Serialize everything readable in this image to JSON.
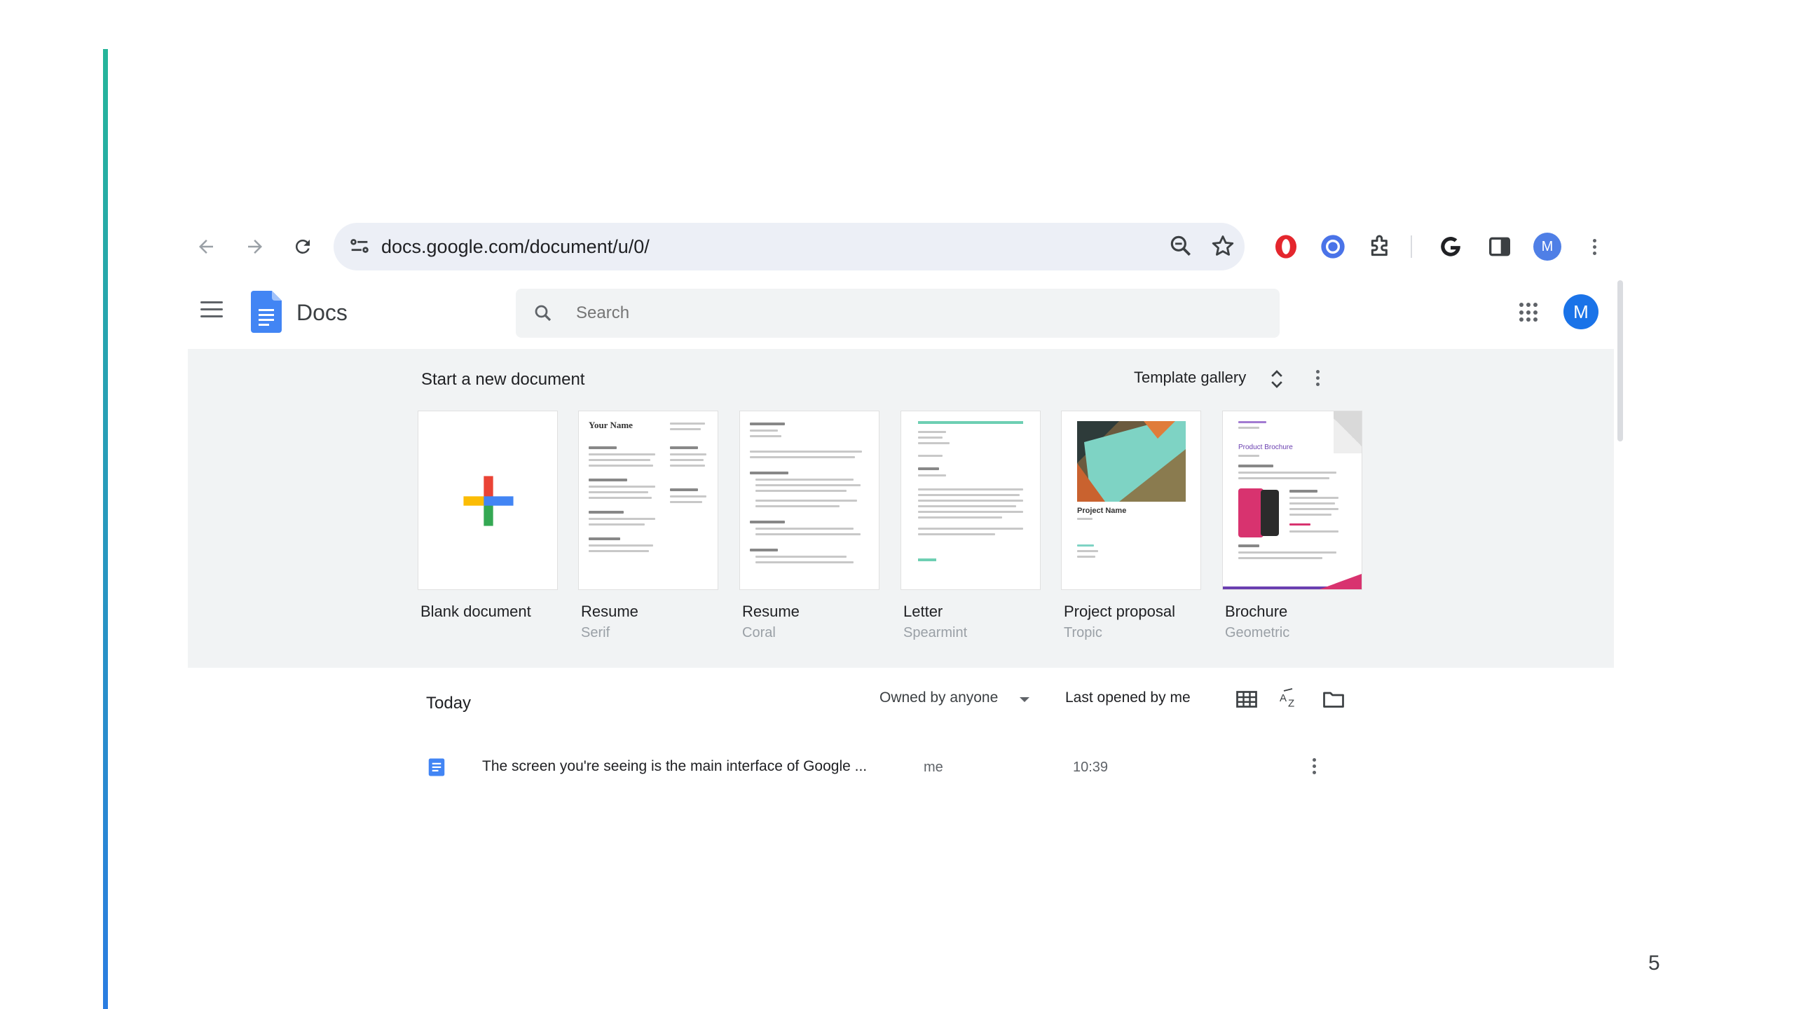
{
  "browser": {
    "url": "docs.google.com/document/u/0/",
    "profile_initial": "M",
    "colors": {
      "opera_red": "#e4262d",
      "ext_blue": "#4a73e8",
      "avatar_blue": "#4f7fe6"
    }
  },
  "app": {
    "name": "Docs",
    "search_placeholder": "Search",
    "account_initial": "M",
    "colors": {
      "accent": "#1a73e8",
      "docs_blue": "#4285f4"
    }
  },
  "templates": {
    "title": "Start a new document",
    "gallery_label": "Template gallery",
    "items": [
      {
        "name": "Blank document",
        "sub": ""
      },
      {
        "name": "Resume",
        "sub": "Serif",
        "thumb_heading": "Your Name"
      },
      {
        "name": "Resume",
        "sub": "Coral"
      },
      {
        "name": "Letter",
        "sub": "Spearmint"
      },
      {
        "name": "Project proposal",
        "sub": "Tropic",
        "thumb_heading": "Project Name"
      },
      {
        "name": "Brochure",
        "sub": "Geometric",
        "thumb_heading": "Product Brochure"
      }
    ]
  },
  "files": {
    "section_label": "Today",
    "owner_filter": "Owned by anyone",
    "sort_label": "Last opened by me",
    "rows": [
      {
        "name": "The screen you're seeing is the main interface of Google ...",
        "owner": "me",
        "time": "10:39"
      }
    ]
  },
  "slide": {
    "page_number": "5"
  }
}
